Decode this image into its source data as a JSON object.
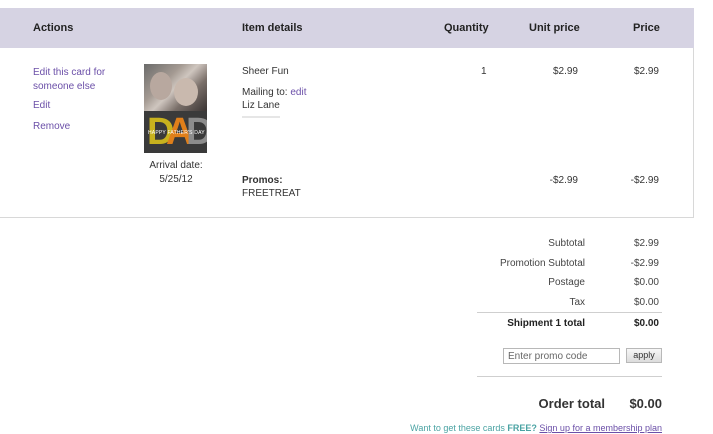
{
  "header": {
    "actions": "Actions",
    "item_details": "Item details",
    "quantity": "Quantity",
    "unit_price": "Unit price",
    "price": "Price"
  },
  "item": {
    "actions": {
      "edit_for_someone_line1": "Edit this card for",
      "edit_for_someone_line2": "someone else",
      "edit": "Edit",
      "remove": "Remove"
    },
    "thumbnail": {
      "big_text": "DAD",
      "tagline": "HAPPY FATHER'S DAY"
    },
    "arrival_label": "Arrival date:",
    "arrival_date": "5/25/12",
    "name": "Sheer Fun",
    "mailing_to_label": "Mailing to:",
    "mailing_to_edit": "edit",
    "recipient": "Liz Lane",
    "quantity": "1",
    "unit_price": "$2.99",
    "price": "$2.99",
    "promos_label": "Promos:",
    "promo_code": "FREETREAT",
    "promo_unit_price": "-$2.99",
    "promo_price": "-$2.99"
  },
  "summary": {
    "subtotal_label": "Subtotal",
    "subtotal": "$2.99",
    "promo_subtotal_label": "Promotion Subtotal",
    "promo_subtotal": "-$2.99",
    "postage_label": "Postage",
    "postage": "$0.00",
    "tax_label": "Tax",
    "tax": "$0.00",
    "shipment_label": "Shipment 1 total",
    "shipment_total": "$0.00"
  },
  "promo_form": {
    "placeholder": "Enter promo code",
    "apply_label": "apply"
  },
  "order_total": {
    "label": "Order total",
    "value": "$0.00"
  },
  "membership": {
    "prefix": "Want to get these cards ",
    "free": "FREE?",
    "link": "Sign up for a membership plan"
  },
  "colors": {
    "header_bg": "#d6d3e3",
    "link": "#6b4fa8",
    "membership_text": "#4aa3a3"
  }
}
